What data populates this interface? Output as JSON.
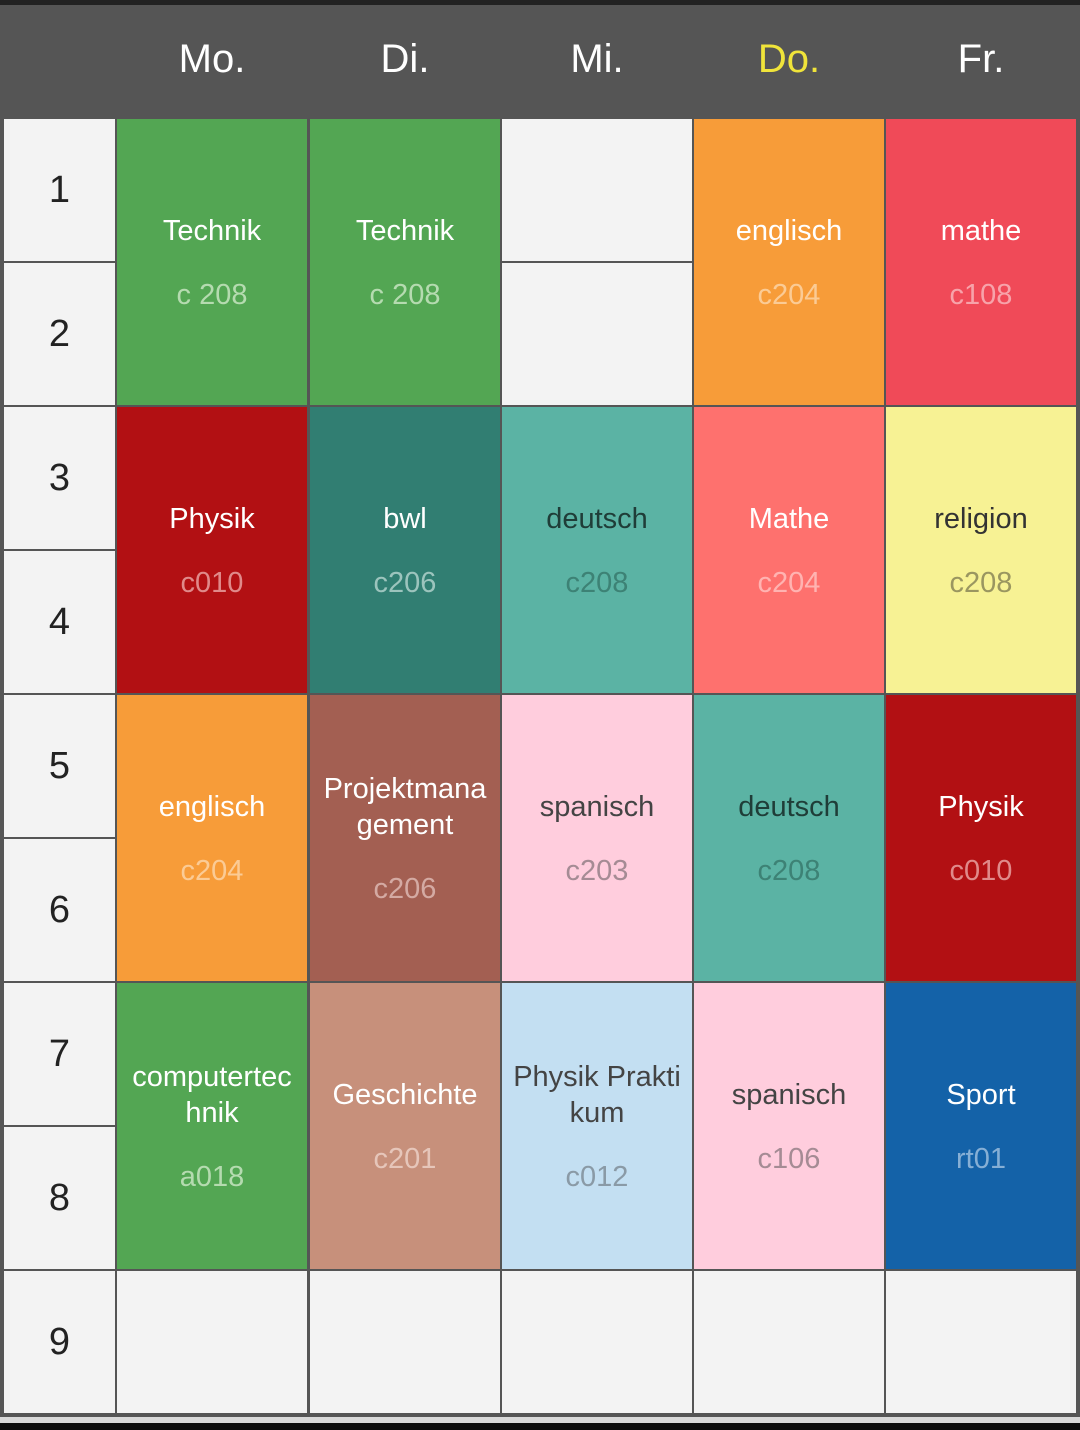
{
  "days": [
    {
      "label": "Mo."
    },
    {
      "label": "Di."
    },
    {
      "label": "Mi."
    },
    {
      "label": "Do.",
      "today": true
    },
    {
      "label": "Fr."
    }
  ],
  "periods": [
    "1",
    "2",
    "3",
    "4",
    "5",
    "6",
    "7",
    "8",
    "9"
  ],
  "today_color": "#f0e43a",
  "lessons": [
    {
      "day": 0,
      "start": 0,
      "span": 2,
      "subject": "Technik",
      "room": "c 208",
      "bg": "#53a653",
      "fg": "#ffffff",
      "room_fg": "#b5dbb0"
    },
    {
      "day": 1,
      "start": 0,
      "span": 2,
      "subject": "Technik",
      "room": "c 208",
      "bg": "#53a653",
      "fg": "#ffffff",
      "room_fg": "#b5dbb0"
    },
    {
      "day": 3,
      "start": 0,
      "span": 2,
      "subject": "englisch",
      "room": "c204",
      "bg": "#f79c39",
      "fg": "#ffffff",
      "room_fg": "#fbcb95"
    },
    {
      "day": 4,
      "start": 0,
      "span": 2,
      "subject": "mathe",
      "room": "c108",
      "bg": "#f04a58",
      "fg": "#ffffff",
      "room_fg": "#f7a3aa"
    },
    {
      "day": 0,
      "start": 2,
      "span": 2,
      "subject": "Physik",
      "room": "c010",
      "bg": "#b21013",
      "fg": "#ffffff",
      "room_fg": "#e08a8a"
    },
    {
      "day": 1,
      "start": 2,
      "span": 2,
      "subject": "bwl",
      "room": "c206",
      "bg": "#317e72",
      "fg": "#ffffff",
      "room_fg": "#9cc4bd"
    },
    {
      "day": 2,
      "start": 2,
      "span": 2,
      "subject": "deutsch",
      "room": "c208",
      "bg": "#5bb3a4",
      "fg": "#1f3d38",
      "room_fg": "#3d8275"
    },
    {
      "day": 3,
      "start": 2,
      "span": 2,
      "subject": "Mathe",
      "room": "c204",
      "bg": "#fe716e",
      "fg": "#ffffff",
      "room_fg": "#ffb3b1"
    },
    {
      "day": 4,
      "start": 2,
      "span": 2,
      "subject": "religion",
      "room": "c208",
      "bg": "#f7f294",
      "fg": "#333333",
      "room_fg": "#9a9660"
    },
    {
      "day": 0,
      "start": 4,
      "span": 2,
      "subject": "englisch",
      "room": "c204",
      "bg": "#f79c39",
      "fg": "#ffffff",
      "room_fg": "#fbcb95"
    },
    {
      "day": 1,
      "start": 4,
      "span": 2,
      "subject": "Projektmana gement",
      "room": "c206",
      "bg": "#a35f52",
      "fg": "#ffffff",
      "room_fg": "#d4aaa3"
    },
    {
      "day": 2,
      "start": 4,
      "span": 2,
      "subject": "spanisch",
      "room": "c203",
      "bg": "#ffcddd",
      "fg": "#444444",
      "room_fg": "#a58b94"
    },
    {
      "day": 3,
      "start": 4,
      "span": 2,
      "subject": "deutsch",
      "room": "c208",
      "bg": "#5bb3a4",
      "fg": "#1f3d38",
      "room_fg": "#3d8275"
    },
    {
      "day": 4,
      "start": 4,
      "span": 2,
      "subject": "Physik",
      "room": "c010",
      "bg": "#b21013",
      "fg": "#ffffff",
      "room_fg": "#e08a8a"
    },
    {
      "day": 0,
      "start": 6,
      "span": 2,
      "subject": "computertec hnik",
      "room": "a018",
      "bg": "#53a653",
      "fg": "#ffffff",
      "room_fg": "#b5dbb0"
    },
    {
      "day": 1,
      "start": 6,
      "span": 2,
      "subject": "Geschichte",
      "room": "c201",
      "bg": "#c7907b",
      "fg": "#ffffff",
      "room_fg": "#e6c6ba"
    },
    {
      "day": 2,
      "start": 6,
      "span": 2,
      "subject": "Physik Prakti kum",
      "room": "c012",
      "bg": "#c3dff2",
      "fg": "#444444",
      "room_fg": "#8a9aa6"
    },
    {
      "day": 3,
      "start": 6,
      "span": 2,
      "subject": "spanisch",
      "room": "c106",
      "bg": "#ffcddd",
      "fg": "#444444",
      "room_fg": "#a58b94"
    },
    {
      "day": 4,
      "start": 6,
      "span": 2,
      "subject": "Sport",
      "room": "rt01",
      "bg": "#1462a8",
      "fg": "#ffffff",
      "room_fg": "#86afd5"
    }
  ],
  "empty_cells": [
    {
      "day": 2,
      "start": 0
    },
    {
      "day": 2,
      "start": 1
    },
    {
      "day": 0,
      "start": 8
    },
    {
      "day": 1,
      "start": 8
    },
    {
      "day": 2,
      "start": 8
    },
    {
      "day": 3,
      "start": 8
    },
    {
      "day": 4,
      "start": 8
    }
  ]
}
